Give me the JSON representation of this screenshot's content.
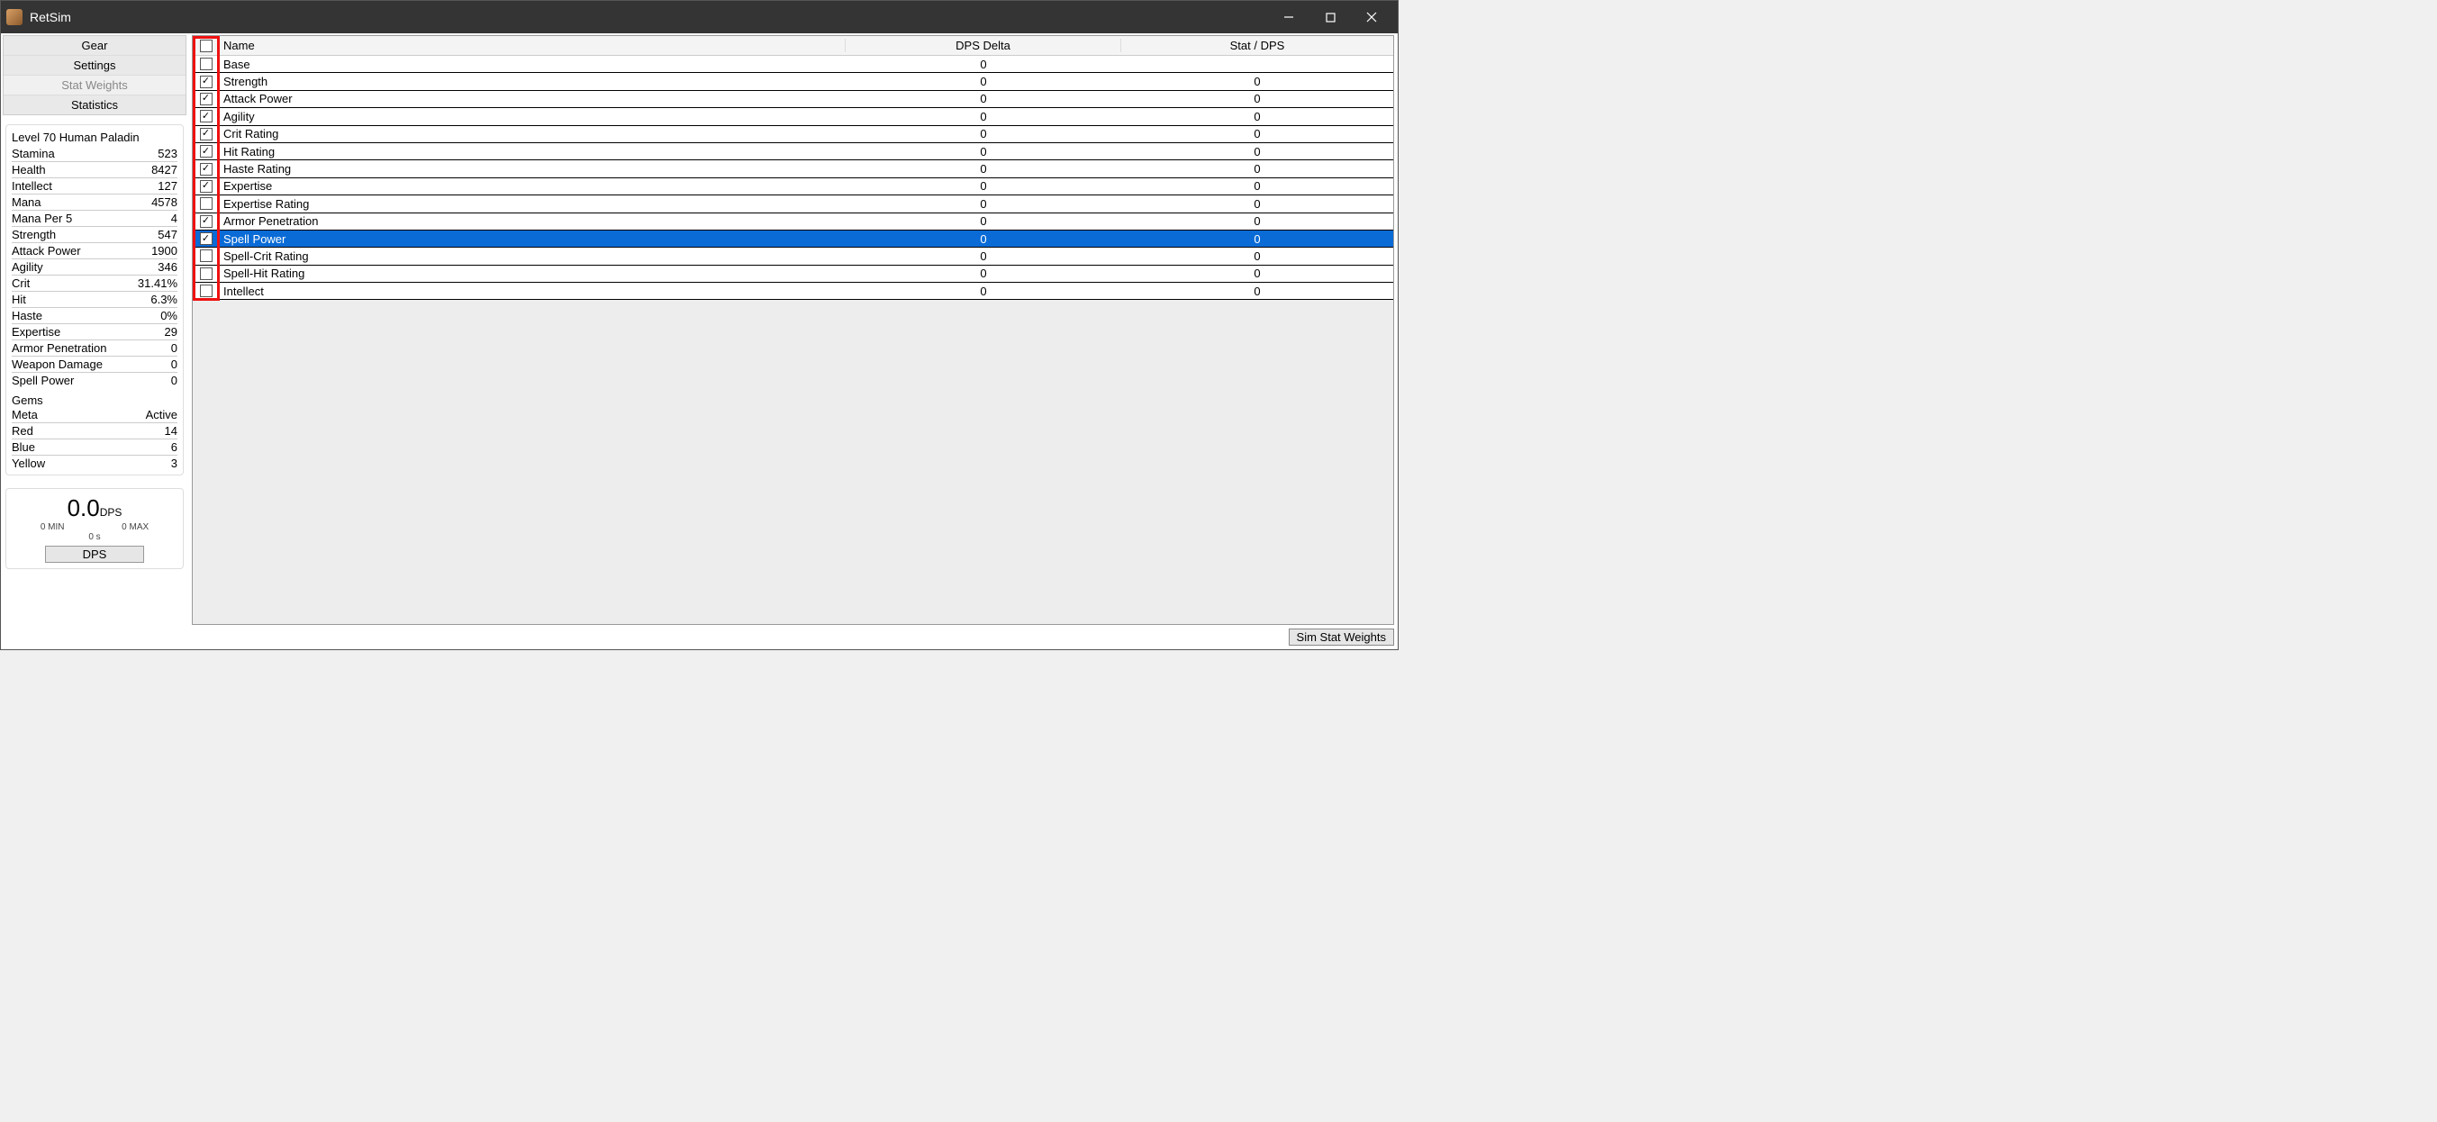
{
  "window": {
    "title": "RetSim"
  },
  "nav": {
    "items": [
      "Gear",
      "Settings",
      "Stat Weights",
      "Statistics"
    ],
    "activeIndex": 2
  },
  "characterTitle": "Level 70 Human Paladin",
  "stats": [
    {
      "label": "Stamina",
      "value": "523"
    },
    {
      "label": "Health",
      "value": "8427"
    },
    {
      "label": "Intellect",
      "value": "127"
    },
    {
      "label": "Mana",
      "value": "4578"
    },
    {
      "label": "Mana Per 5",
      "value": "4"
    },
    {
      "label": "Strength",
      "value": "547"
    },
    {
      "label": "Attack Power",
      "value": "1900"
    },
    {
      "label": "Agility",
      "value": "346"
    },
    {
      "label": "Crit",
      "value": "31.41%"
    },
    {
      "label": "Hit",
      "value": "6.3%"
    },
    {
      "label": "Haste",
      "value": "0%"
    },
    {
      "label": "Expertise",
      "value": "29"
    },
    {
      "label": "Armor Penetration",
      "value": "0"
    },
    {
      "label": "Weapon Damage",
      "value": "0"
    },
    {
      "label": "Spell Power",
      "value": "0"
    }
  ],
  "gemsTitle": "Gems",
  "gems": [
    {
      "label": "Meta",
      "value": "Active"
    },
    {
      "label": "Red",
      "value": "14"
    },
    {
      "label": "Blue",
      "value": "6"
    },
    {
      "label": "Yellow",
      "value": "3"
    }
  ],
  "dpsPanel": {
    "value": "0.0",
    "unit": "DPS",
    "min": "0 MIN",
    "max": "0 MAX",
    "time": "0 s",
    "button": "DPS"
  },
  "grid": {
    "headers": {
      "name": "Name",
      "delta": "DPS Delta",
      "stat": "Stat / DPS"
    },
    "rows": [
      {
        "checked": false,
        "name": "Base",
        "delta": "0",
        "stat": ""
      },
      {
        "checked": true,
        "name": "Strength",
        "delta": "0",
        "stat": "0"
      },
      {
        "checked": true,
        "name": "Attack Power",
        "delta": "0",
        "stat": "0"
      },
      {
        "checked": true,
        "name": "Agility",
        "delta": "0",
        "stat": "0"
      },
      {
        "checked": true,
        "name": "Crit Rating",
        "delta": "0",
        "stat": "0"
      },
      {
        "checked": true,
        "name": "Hit Rating",
        "delta": "0",
        "stat": "0"
      },
      {
        "checked": true,
        "name": "Haste Rating",
        "delta": "0",
        "stat": "0"
      },
      {
        "checked": true,
        "name": "Expertise",
        "delta": "0",
        "stat": "0"
      },
      {
        "checked": false,
        "name": "Expertise Rating",
        "delta": "0",
        "stat": "0"
      },
      {
        "checked": true,
        "name": "Armor Penetration",
        "delta": "0",
        "stat": "0"
      },
      {
        "checked": true,
        "name": "Spell Power",
        "delta": "0",
        "stat": "0",
        "selected": true
      },
      {
        "checked": false,
        "name": "Spell-Crit Rating",
        "delta": "0",
        "stat": "0"
      },
      {
        "checked": false,
        "name": "Spell-Hit Rating",
        "delta": "0",
        "stat": "0"
      },
      {
        "checked": false,
        "name": "Intellect",
        "delta": "0",
        "stat": "0"
      }
    ],
    "selectedIndex": 10
  },
  "simButton": "Sim Stat Weights"
}
